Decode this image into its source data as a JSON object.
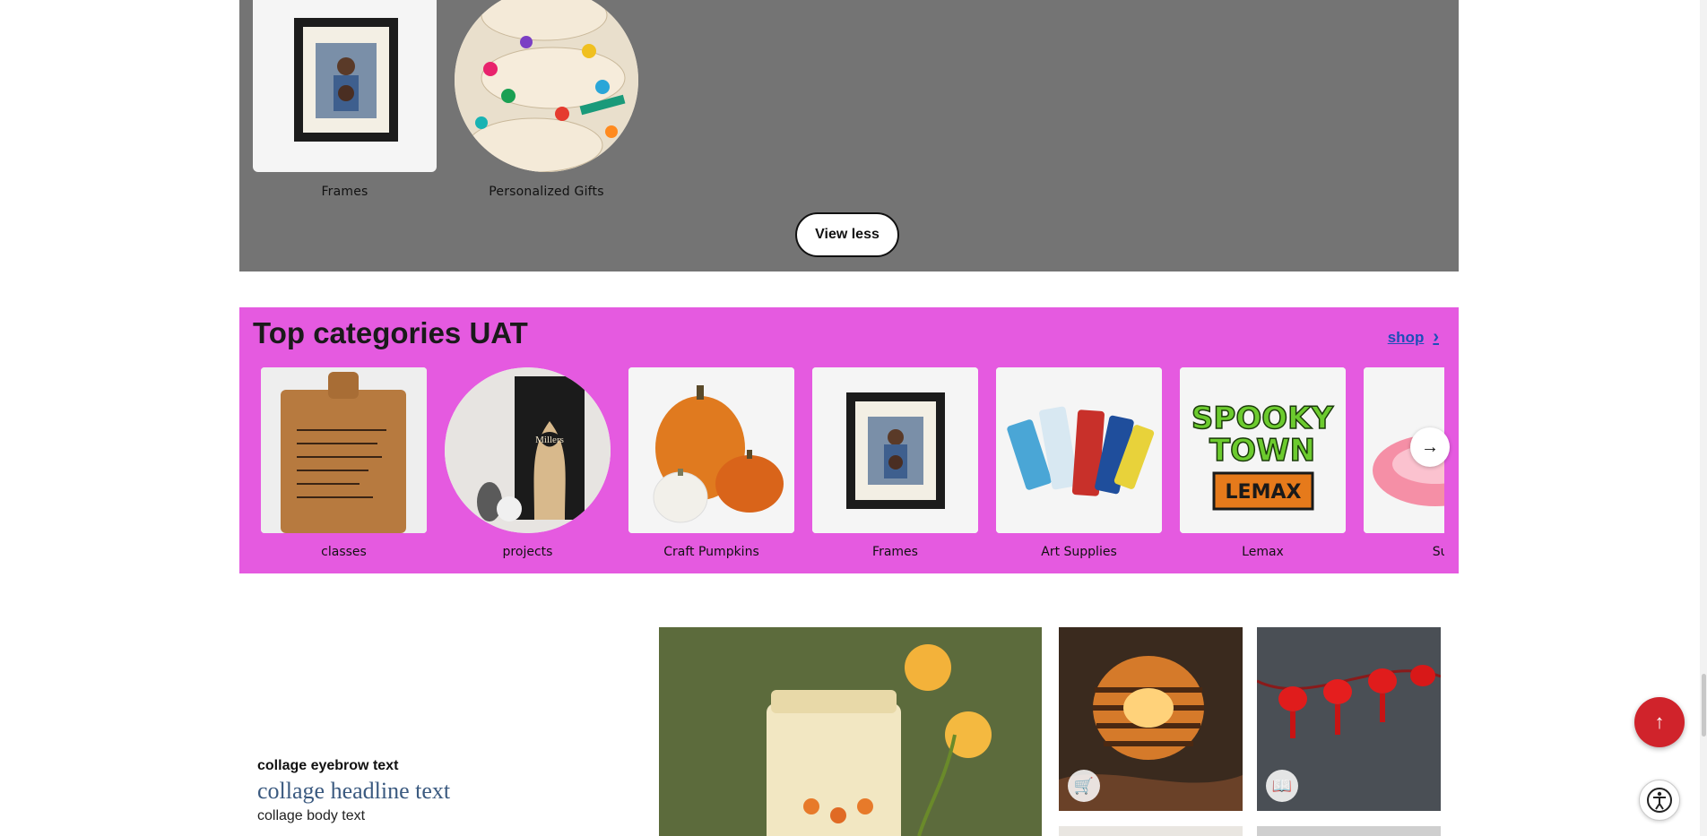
{
  "featured": {
    "items": [
      {
        "label": "Frames",
        "icon": "frame-photo"
      },
      {
        "label": "Personalized Gifts",
        "icon": "painted-name-plaques"
      }
    ],
    "view_less_label": "View less"
  },
  "top_categories": {
    "title": "Top categories UAT",
    "shop_label": "shop",
    "items": [
      {
        "label": "classes",
        "icon": "cutting-board"
      },
      {
        "label": "projects",
        "icon": "carved-tree-sign"
      },
      {
        "label": "Craft Pumpkins",
        "icon": "pumpkins"
      },
      {
        "label": "Frames",
        "icon": "frame-photo"
      },
      {
        "label": "Art Supplies",
        "icon": "paint-tubes"
      },
      {
        "label": "Lemax",
        "icon": "spooky-town-logo"
      },
      {
        "label": "Sum",
        "icon": "pink-pool-float"
      }
    ],
    "logo_text": {
      "line1": "SPOOKY",
      "line2": "TOWN",
      "brand": "LEMAX"
    },
    "sign_text": "Millers"
  },
  "collage": {
    "eyebrow": "collage eyebrow text",
    "headline": "collage headline text",
    "body": "collage body text"
  },
  "colors": {
    "gray_band": "#747474",
    "pink_band": "#e55ae0",
    "shop_link": "#1b4fb8",
    "back_to_top": "#d0232b",
    "headline": "#3b5a80"
  }
}
